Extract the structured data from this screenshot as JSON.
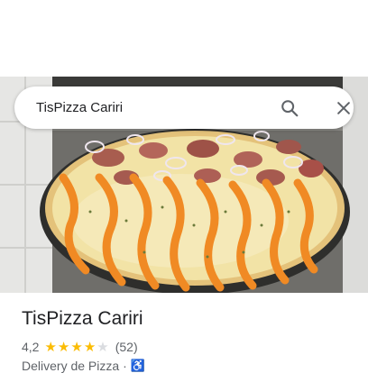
{
  "search": {
    "query": "TisPizza Cariri"
  },
  "place": {
    "name": "TisPizza Cariri",
    "rating": "4,2",
    "rating_fraction": 0.84,
    "stars_full": 4,
    "stars_total": 5,
    "review_count": "(52)",
    "category": "Delivery de Pizza",
    "separator": "·",
    "accessibility_icon": "wheelchair-accessible-icon"
  },
  "colors": {
    "star": "#fbbc04",
    "star_empty": "#dadce0",
    "accent": "#1a73e8",
    "text_primary": "#202124",
    "text_secondary": "#5f6368"
  },
  "icons": {
    "search": "search-icon",
    "close": "close-icon"
  }
}
